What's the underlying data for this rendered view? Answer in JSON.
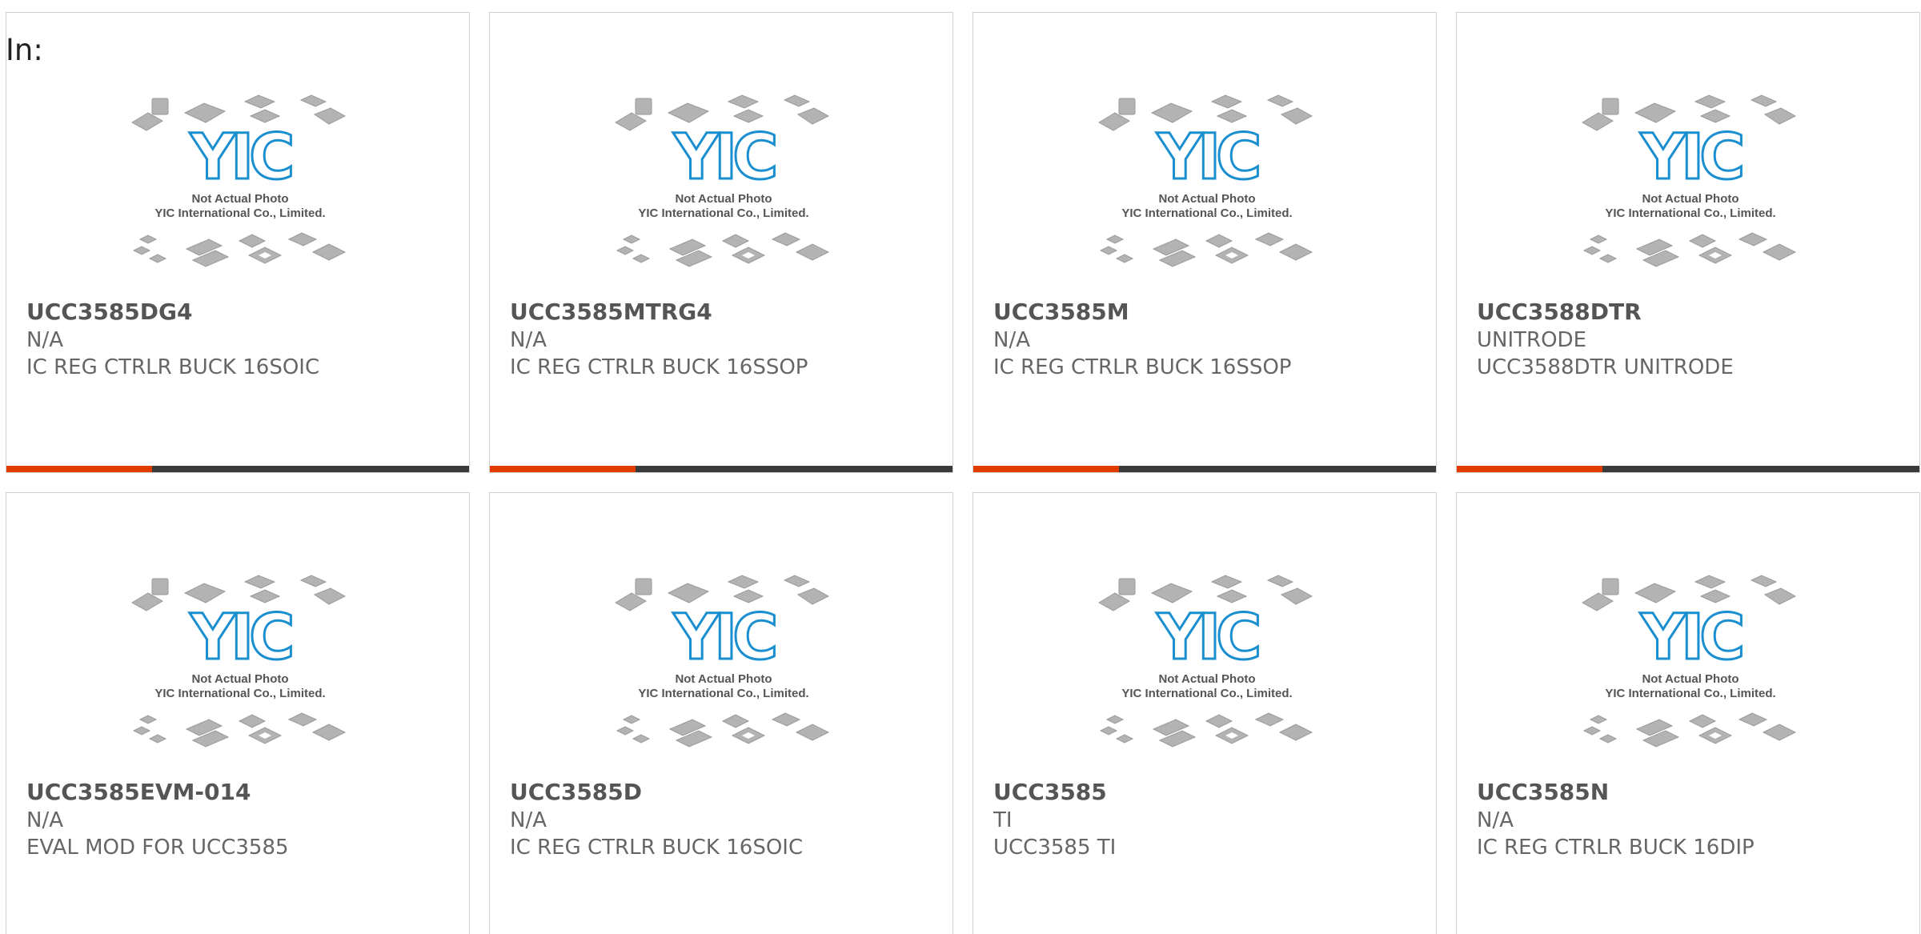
{
  "page": {
    "heading": "In:"
  },
  "theme": {
    "accent_color": "#e23c00",
    "bar_color": "#3a3a3a",
    "logo_color": "#1a8fd0"
  },
  "placeholder_image": {
    "caption_line1": "Not Actual Photo",
    "caption_line2": "YIC International Co., Limited.",
    "logo_text": "YIC"
  },
  "products": [
    {
      "part": "UCC3585DG4",
      "maker": "N/A",
      "desc": "IC REG CTRLR BUCK 16SOIC"
    },
    {
      "part": "UCC3585MTRG4",
      "maker": "N/A",
      "desc": "IC REG CTRLR BUCK 16SSOP"
    },
    {
      "part": "UCC3585M",
      "maker": "N/A",
      "desc": "IC REG CTRLR BUCK 16SSOP"
    },
    {
      "part": "UCC3588DTR",
      "maker": "UNITRODE",
      "desc": "UCC3588DTR UNITRODE"
    },
    {
      "part": "UCC3585EVM-014",
      "maker": "N/A",
      "desc": "EVAL MOD FOR UCC3585"
    },
    {
      "part": "UCC3585D",
      "maker": "N/A",
      "desc": "IC REG CTRLR BUCK 16SOIC"
    },
    {
      "part": "UCC3585",
      "maker": "TI",
      "desc": "UCC3585 TI"
    },
    {
      "part": "UCC3585N",
      "maker": "N/A",
      "desc": "IC REG CTRLR BUCK 16DIP"
    }
  ]
}
